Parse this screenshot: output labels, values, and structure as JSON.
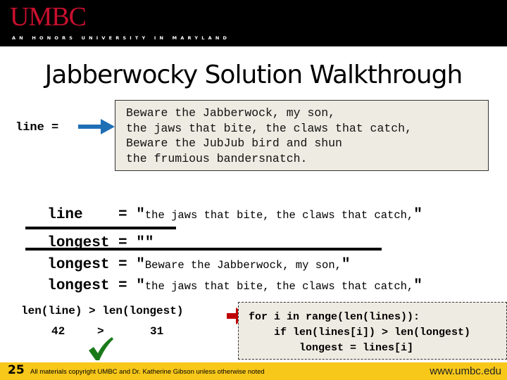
{
  "header": {
    "logo": "UMBC",
    "tagline": "AN HONORS UNIVERSITY IN MARYLAND"
  },
  "title": "Jabberwocky Solution Walkthrough",
  "line_pointer": {
    "label": "line =",
    "arrow_color": "#1f6fb5"
  },
  "poem": {
    "lines": [
      "Beware the Jabberwock, my son,",
      "the jaws that bite, the claws that catch,",
      "Beware the JubJub bird and shun",
      "the frumious bandersnatch."
    ]
  },
  "assignments": [
    {
      "name": "line   ",
      "op": "=",
      "value": "the jaws that bite, the claws that catch,",
      "struck": false
    },
    {
      "name": "longest",
      "op": "=",
      "value": "",
      "struck": true
    },
    {
      "name": "longest",
      "op": "=",
      "value": "Beware the Jabberwock, my son,",
      "struck": true
    },
    {
      "name": "longest",
      "op": "=",
      "value": "the jaws that bite, the claws that catch,",
      "struck": false
    }
  ],
  "comparison": {
    "expression": "len(line) > len(longest)",
    "left": "42",
    "op": ">",
    "right": "31",
    "result": "true",
    "check_color": "#1a7a1a"
  },
  "code": {
    "lines": [
      "for i in range(len(lines)):",
      "    if len(lines[i]) > len(longest)",
      "        longest = lines[i]"
    ],
    "current_line_arrow_color": "#c00000"
  },
  "footer": {
    "slide_number": "25",
    "copyright": "All materials copyright UMBC and Dr. Katherine Gibson unless otherwise noted",
    "url": "www.umbc.edu"
  }
}
